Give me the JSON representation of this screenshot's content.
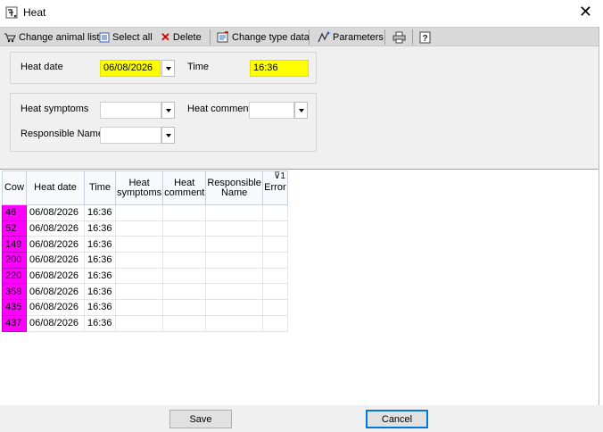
{
  "window": {
    "title": "Heat"
  },
  "toolbar": {
    "change_animal_list": "Change animal list",
    "select_all": "Select all",
    "delete": "Delete",
    "change_type_data": "Change type data",
    "parameters": "Parameters"
  },
  "form": {
    "heat_date_label": "Heat date",
    "heat_date_value": "06/08/2026",
    "time_label": "Time",
    "time_value": "16:36",
    "heat_symptoms_label": "Heat symptoms",
    "heat_symptoms_value": "",
    "heat_comment_label": "Heat comment",
    "heat_comment_value": "",
    "responsible_name_label": "Responsible Name",
    "responsible_name_value": ""
  },
  "grid": {
    "columns": [
      "Cow",
      "Heat date",
      "Time",
      "Heat symptoms",
      "Heat comment",
      "Responsible Name",
      "Error"
    ],
    "rows": [
      {
        "cow": "46",
        "date": "06/08/2026",
        "time": "16:36",
        "symptoms": "",
        "comment": "",
        "responsible": "",
        "error": ""
      },
      {
        "cow": "52",
        "date": "06/08/2026",
        "time": "16:36",
        "symptoms": "",
        "comment": "",
        "responsible": "",
        "error": ""
      },
      {
        "cow": "149",
        "date": "06/08/2026",
        "time": "16:36",
        "symptoms": "",
        "comment": "",
        "responsible": "",
        "error": ""
      },
      {
        "cow": "200",
        "date": "06/08/2026",
        "time": "16:36",
        "symptoms": "",
        "comment": "",
        "responsible": "",
        "error": ""
      },
      {
        "cow": "220",
        "date": "06/08/2026",
        "time": "16:36",
        "symptoms": "",
        "comment": "",
        "responsible": "",
        "error": ""
      },
      {
        "cow": "358",
        "date": "06/08/2026",
        "time": "16:36",
        "symptoms": "",
        "comment": "",
        "responsible": "",
        "error": ""
      },
      {
        "cow": "435",
        "date": "06/08/2026",
        "time": "16:36",
        "symptoms": "",
        "comment": "",
        "responsible": "",
        "error": ""
      },
      {
        "cow": "437",
        "date": "06/08/2026",
        "time": "16:36",
        "symptoms": "",
        "comment": "",
        "responsible": "",
        "error": ""
      }
    ],
    "filter_badge": "1"
  },
  "buttons": {
    "save": "Save",
    "cancel": "Cancel"
  },
  "colors": {
    "cow_cell": "#ff00ff",
    "highlight_field": "#ffff00",
    "toolbar": "#d9d9d9"
  },
  "icons": [
    "app-icon",
    "close-icon",
    "change-list-icon",
    "select-all-icon",
    "delete-icon",
    "change-type-icon",
    "parameters-icon",
    "print-icon",
    "help-icon",
    "filter-icon",
    "dropdown-arrow-icon"
  ]
}
